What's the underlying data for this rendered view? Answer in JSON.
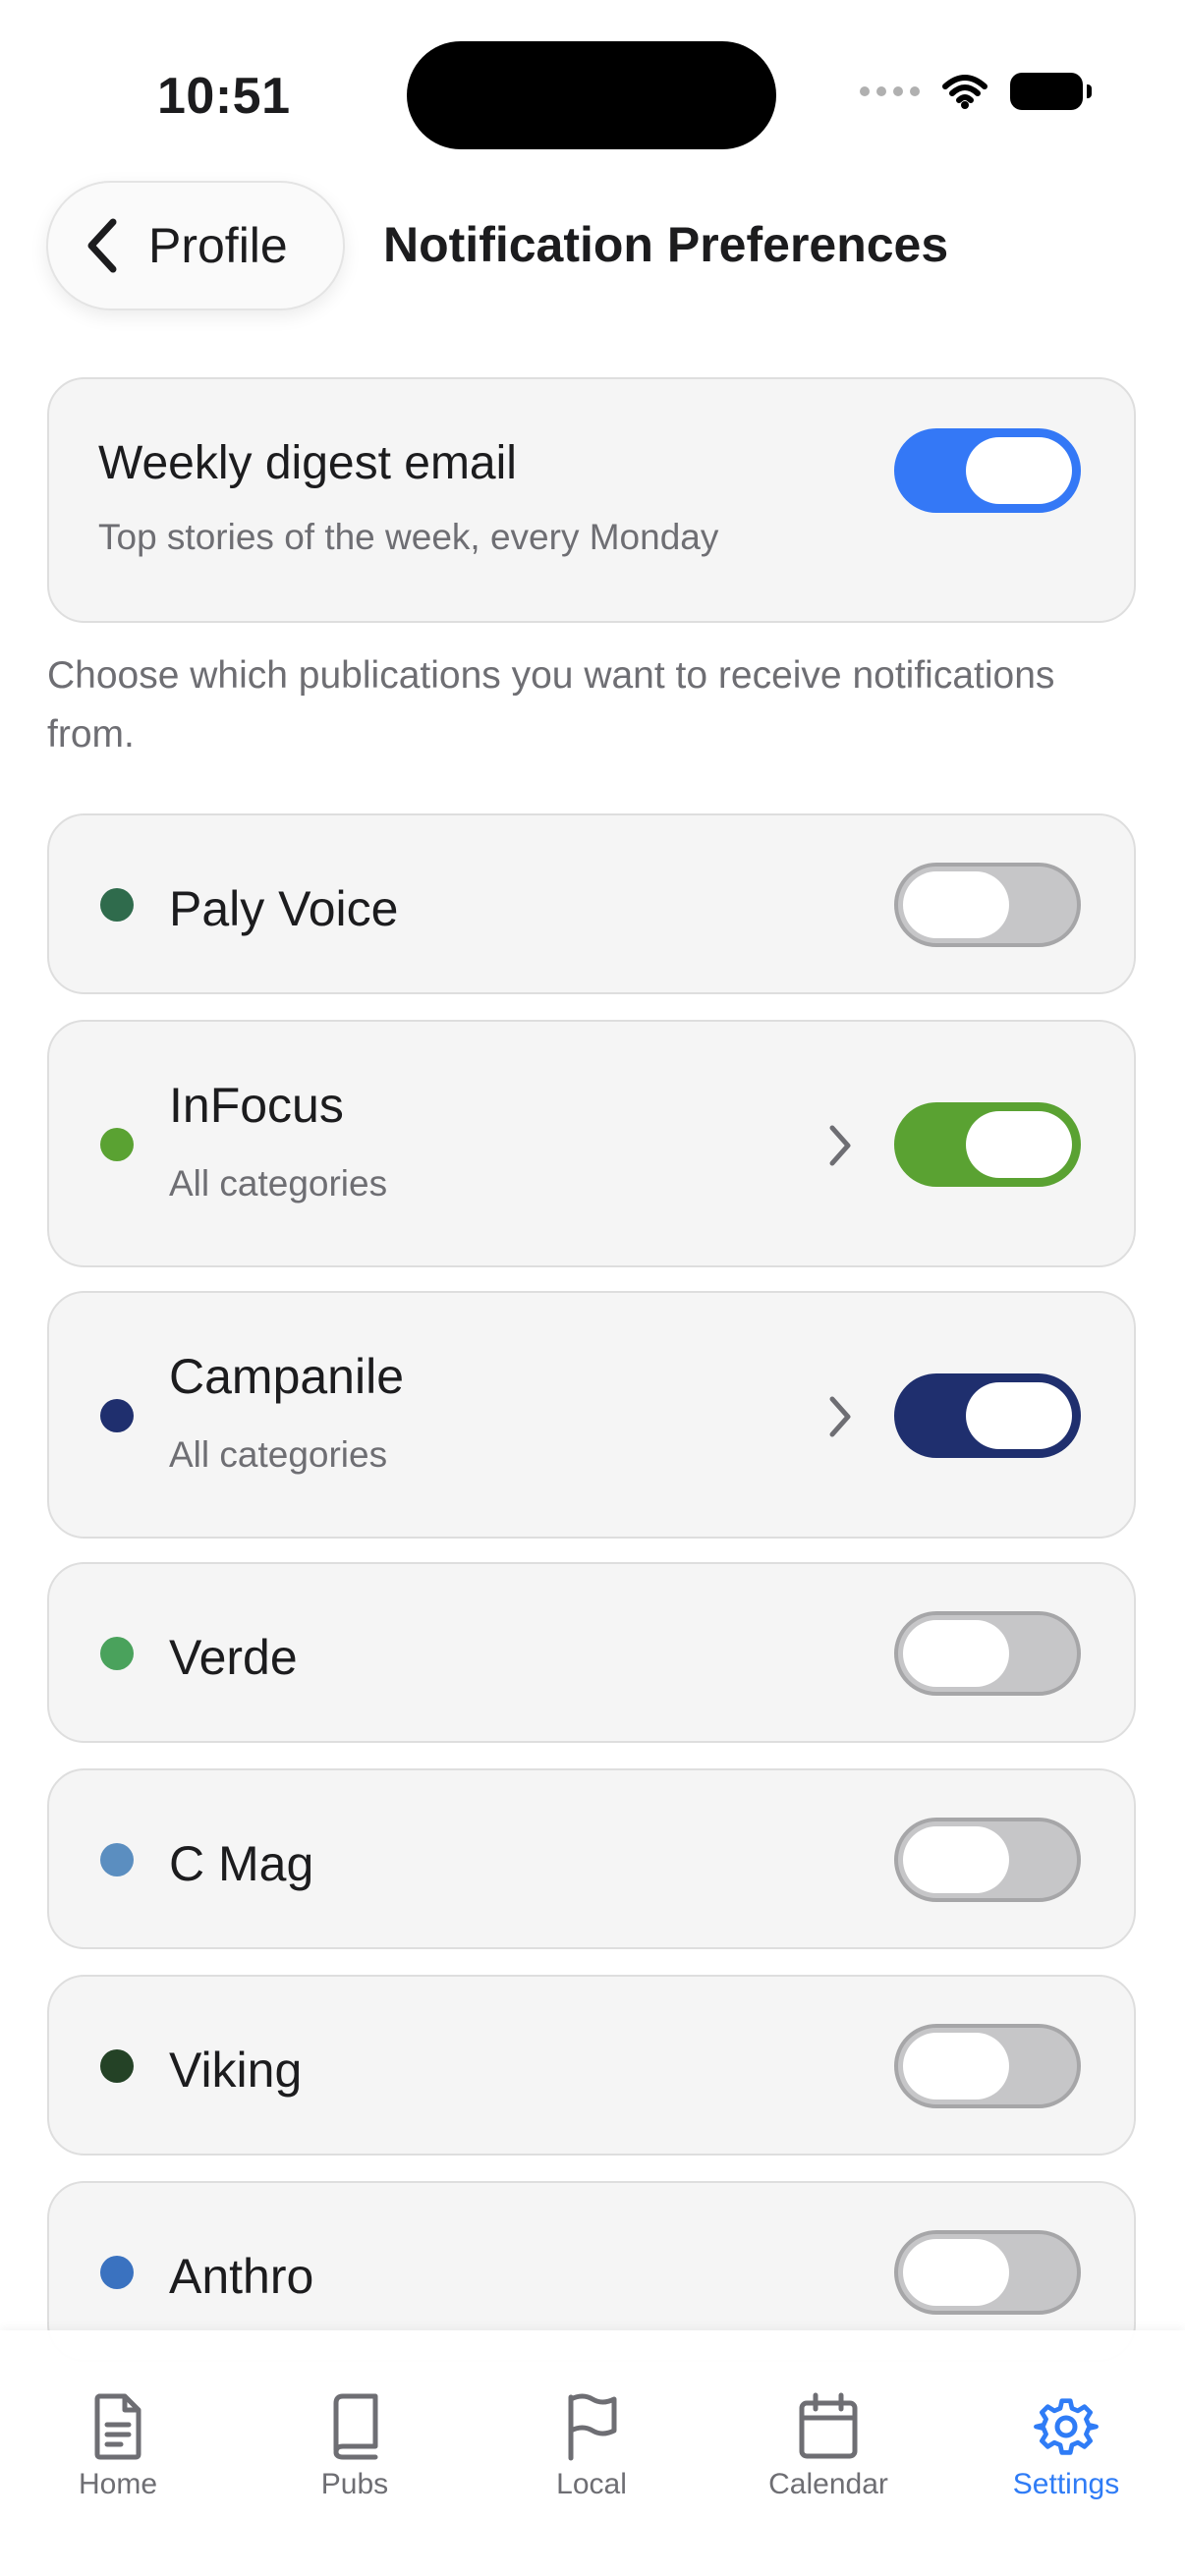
{
  "status_bar": {
    "time": "10:51"
  },
  "nav": {
    "back_label": "Profile",
    "title": "Notification Preferences"
  },
  "digest": {
    "title": "Weekly digest email",
    "subtitle": "Top stories of the week, every Monday",
    "enabled": true,
    "toggle_color": "#3478f6"
  },
  "intro": "Choose which publications you want to receive notifications from.",
  "publications": [
    {
      "name": "Paly Voice",
      "subtitle": "",
      "enabled": false,
      "color": "#2f6b4c",
      "has_chevron": false
    },
    {
      "name": "InFocus",
      "subtitle": "All categories",
      "enabled": true,
      "color": "#5aa232",
      "has_chevron": true
    },
    {
      "name": "Campanile",
      "subtitle": "All categories",
      "enabled": true,
      "color": "#1f2f6e",
      "has_chevron": true
    },
    {
      "name": "Verde",
      "subtitle": "",
      "enabled": false,
      "color": "#4aa25c",
      "has_chevron": false
    },
    {
      "name": "C Mag",
      "subtitle": "",
      "enabled": false,
      "color": "#5b8ec0",
      "has_chevron": false
    },
    {
      "name": "Viking",
      "subtitle": "",
      "enabled": false,
      "color": "#244226",
      "has_chevron": false
    },
    {
      "name": "Anthro",
      "subtitle": "",
      "enabled": false,
      "color": "#3a72c0",
      "has_chevron": false
    }
  ],
  "tabbar": {
    "active_color": "#2f7cf6",
    "tabs": [
      {
        "label": "Home",
        "icon": "document-icon",
        "active": false
      },
      {
        "label": "Pubs",
        "icon": "book-icon",
        "active": false
      },
      {
        "label": "Local",
        "icon": "flag-icon",
        "active": false
      },
      {
        "label": "Calendar",
        "icon": "calendar-icon",
        "active": false
      },
      {
        "label": "Settings",
        "icon": "gear-icon",
        "active": true
      }
    ]
  }
}
